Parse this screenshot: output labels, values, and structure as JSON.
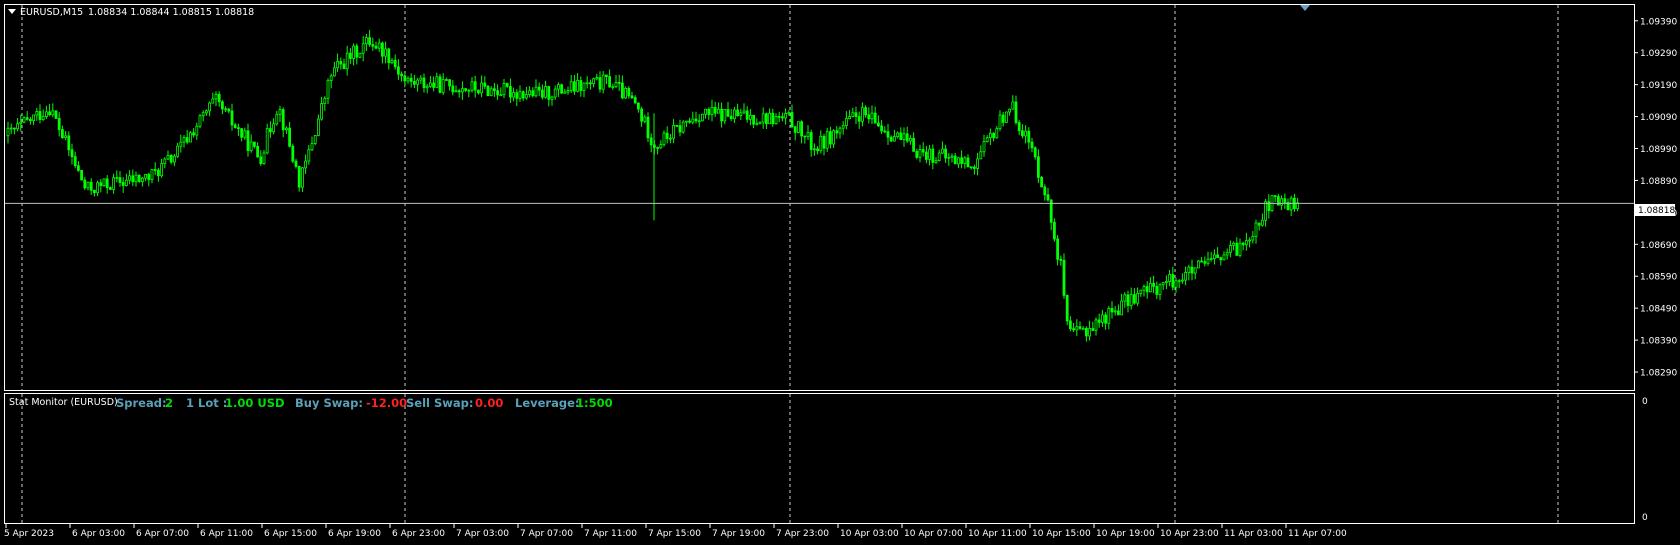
{
  "window": {
    "symbol_timeframe": "EURUSD,M15",
    "ohlc": "1.08834 1.08844 1.08815 1.08818",
    "current_price": "1.08818"
  },
  "indicator": {
    "name": "Stat Monitor (EURUSD)",
    "spread_label": "Spread:",
    "spread_value": "2",
    "lot_label": "1 Lot :",
    "lot_value": "1.00 USD",
    "buy_swap_label": "Buy Swap:",
    "buy_swap_value": "-12.00",
    "sell_swap_label": "Sell Swap:",
    "sell_swap_value": "0.00",
    "leverage_label": "Leverage:",
    "leverage_value": "1:500",
    "scale_top": "0",
    "scale_bottom": "0"
  },
  "colors": {
    "background": "#000000",
    "candle": "#00ff00",
    "grid": "#ffffff",
    "label_teal": "#5aa0b8",
    "value_green": "#00dd00",
    "value_red": "#ff2020"
  },
  "chart_data": {
    "type": "candlestick",
    "title": "EURUSD,M15",
    "price_axis_labels": [
      "1.09390",
      "1.09290",
      "1.09190",
      "1.09090",
      "1.08990",
      "1.08890",
      "1.08790",
      "1.08690",
      "1.08590",
      "1.08490",
      "1.08390",
      "1.08290"
    ],
    "time_axis_labels": [
      "5 Apr 2023",
      "6 Apr 03:00",
      "6 Apr 07:00",
      "6 Apr 11:00",
      "6 Apr 15:00",
      "6 Apr 19:00",
      "6 Apr 23:00",
      "7 Apr 03:00",
      "7 Apr 07:00",
      "7 Apr 11:00",
      "7 Apr 15:00",
      "7 Apr 19:00",
      "7 Apr 23:00",
      "10 Apr 03:00",
      "10 Apr 07:00",
      "10 Apr 11:00",
      "10 Apr 15:00",
      "10 Apr 19:00",
      "10 Apr 23:00",
      "11 Apr 03:00",
      "11 Apr 07:00"
    ],
    "ylim": [
      1.0824,
      1.0943
    ],
    "current_price": 1.08818,
    "series": [
      {
        "values": [
          {
            "t": "5 Apr 2023",
            "p": 1.0903
          },
          {
            "t": "6 Apr 01:00",
            "p": 1.0912
          },
          {
            "t": "6 Apr 03:00",
            "p": 1.0886
          },
          {
            "t": "6 Apr 05:00",
            "p": 1.0888
          },
          {
            "t": "6 Apr 07:00",
            "p": 1.089
          },
          {
            "t": "6 Apr 09:00",
            "p": 1.0897
          },
          {
            "t": "6 Apr 10:00",
            "p": 1.0914
          },
          {
            "t": "6 Apr 12:00",
            "p": 1.0896
          },
          {
            "t": "6 Apr 14:00",
            "p": 1.0913
          },
          {
            "t": "6 Apr 15:30",
            "p": 1.0888
          },
          {
            "t": "6 Apr 17:00",
            "p": 1.0923
          },
          {
            "t": "6 Apr 19:00",
            "p": 1.0933
          },
          {
            "t": "6 Apr 21:00",
            "p": 1.0928
          },
          {
            "t": "6 Apr 23:00",
            "p": 1.092
          },
          {
            "t": "7 Apr 03:00",
            "p": 1.0918
          },
          {
            "t": "7 Apr 07:00",
            "p": 1.0916
          },
          {
            "t": "7 Apr 11:00",
            "p": 1.092
          },
          {
            "t": "7 Apr 13:00",
            "p": 1.0913
          },
          {
            "t": "7 Apr 15:00",
            "p": 1.09
          },
          {
            "t": "7 Apr 17:00",
            "p": 1.091
          },
          {
            "t": "7 Apr 19:00",
            "p": 1.0908
          },
          {
            "t": "7 Apr 23:00",
            "p": 1.0899
          },
          {
            "t": "10 Apr 01:00",
            "p": 1.091
          },
          {
            "t": "10 Apr 05:00",
            "p": 1.0898
          },
          {
            "t": "10 Apr 09:00",
            "p": 1.0894
          },
          {
            "t": "10 Apr 11:00",
            "p": 1.0913
          },
          {
            "t": "10 Apr 13:00",
            "p": 1.09
          },
          {
            "t": "10 Apr 14:00",
            "p": 1.0886
          },
          {
            "t": "10 Apr 15:00",
            "p": 1.086
          },
          {
            "t": "10 Apr 16:30",
            "p": 1.084
          },
          {
            "t": "10 Apr 18:00",
            "p": 1.0843
          },
          {
            "t": "10 Apr 20:00",
            "p": 1.0853
          },
          {
            "t": "10 Apr 23:00",
            "p": 1.086
          },
          {
            "t": "11 Apr 02:00",
            "p": 1.0868
          },
          {
            "t": "11 Apr 04:00",
            "p": 1.0882
          },
          {
            "t": "11 Apr 07:00",
            "p": 1.08818
          }
        ]
      }
    ]
  }
}
